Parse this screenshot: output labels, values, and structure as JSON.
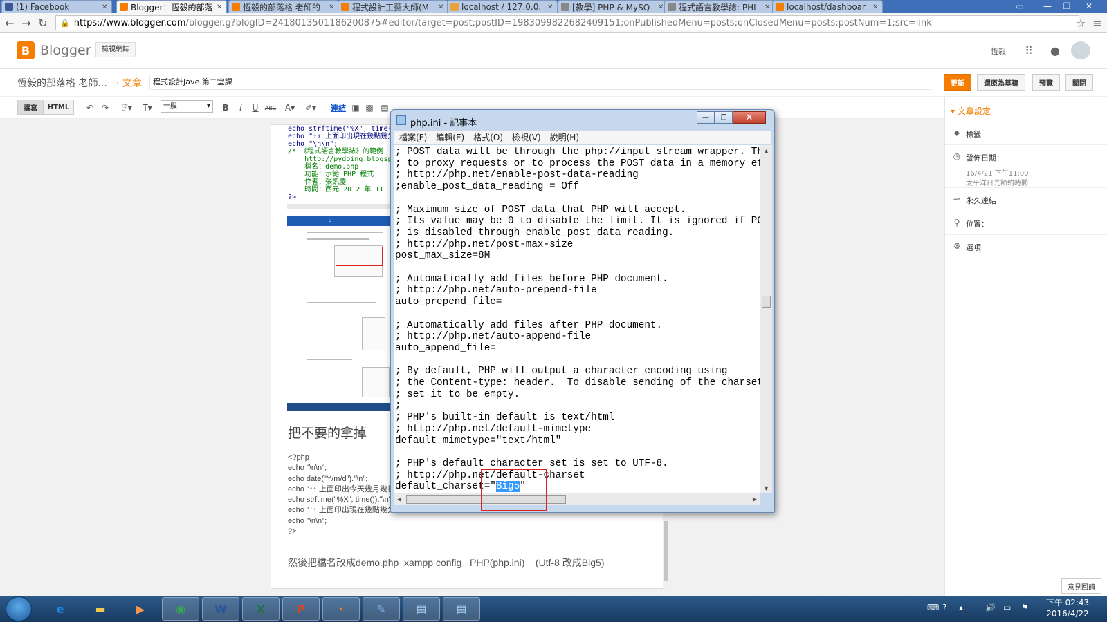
{
  "browser": {
    "tabs": [
      {
        "title": "(1) Facebook",
        "favicon": "facebook-icon",
        "color": "#3b5998"
      },
      {
        "title": "Blogger：恆毅的部落",
        "favicon": "blogger-icon",
        "color": "#f57d00"
      },
      {
        "title": "恆毅的部落格 老師的",
        "favicon": "blogger-icon",
        "color": "#f57d00"
      },
      {
        "title": "程式設計工藝大師(M",
        "favicon": "blogger-icon",
        "color": "#f57d00"
      },
      {
        "title": "localhost / 127.0.0.",
        "favicon": "phpmyadmin-icon",
        "color": "#e8a33d"
      },
      {
        "title": "[教學] PHP & MySQ",
        "favicon": "page-icon",
        "color": "#888888"
      },
      {
        "title": "程式語言教學誌: PHI",
        "favicon": "page-icon",
        "color": "#888888"
      },
      {
        "title": "localhost/dashboar",
        "favicon": "xampp-icon",
        "color": "#f57d00"
      }
    ],
    "url_host": "https://www.blogger.com",
    "url_rest": "/blogger.g?blogID=2418013501186200875#editor/target=post;postID=1983099822682409151;onPublishedMenu=posts;onClosedMenu=posts;postNum=1;src=link"
  },
  "blogger": {
    "logo_text": "Blogger",
    "view_blog": "檢視網誌",
    "user": "恆毅",
    "blog_title": "恆毅的部落格 老師...",
    "crumb": "· 文章",
    "post_title": "程式設計Jave 第二堂課",
    "buttons": {
      "update": "更新",
      "revert": "還原為草稿",
      "preview": "預覽",
      "close": "關閉"
    }
  },
  "toolbar": {
    "compose": "撰寫",
    "html": "HTML",
    "font_size": "一般",
    "link": "連結"
  },
  "editor": {
    "code_head": [
      "echo strftime(\"%X\", time()).\"\\n\";",
      "echo \"↑↑ 上面印出現在幾點幾分",
      "echo \"\\n\\n\";",
      "/* 《程式語言教學誌》的範例",
      "    http://pydoing.blogspo",
      "    檔名：demo.php",
      "    功能：示範 PHP 程式",
      "    作者：張凱慶",
      "    時間：西元 2012 年 11",
      "?>"
    ],
    "heading": "把不要的拿掉",
    "code_lines": [
      "<?php",
      "echo \"\\n\\n\";",
      "echo date(\"Y/m/d\").\"\\n\";",
      "echo \"↑↑ 上面印出今天幾月幾日",
      "echo strftime(\"%X\", time()).\"\\n\"",
      "echo \"↑↑ 上面印出現在幾點幾分",
      "echo \"\\n\\n\";",
      "?>"
    ],
    "bottom_line": "然後把檔名改成demo.php  xampp config   PHP(php.ini)    (Utf-8 改成Big5)"
  },
  "sidebar": {
    "title": "▾ 文章設定",
    "labels": "標籤",
    "publish_date": "發佈日期：",
    "publish_value": "16/4/21 下午11:00",
    "timezone": "太平洋日光節約時間",
    "permalink": "永久連結",
    "location": "位置：",
    "options": "選項"
  },
  "notepad": {
    "title": "php.ini - 記事本",
    "menu": [
      "檔案(F)",
      "編輯(E)",
      "格式(O)",
      "檢視(V)",
      "說明(H)"
    ],
    "lines": [
      "; POST data will be through the php://input stream wrapper. Th",
      "; to proxy requests or to process the POST data in a memory ef",
      "; http://php.net/enable-post-data-reading",
      ";enable_post_data_reading = Off",
      "",
      "; Maximum size of POST data that PHP will accept.",
      "; Its value may be 0 to disable the limit. It is ignored if PO",
      "; is disabled through enable_post_data_reading.",
      "; http://php.net/post-max-size",
      "post_max_size=8M",
      "",
      "; Automatically add files before PHP document.",
      "; http://php.net/auto-prepend-file",
      "auto_prepend_file=",
      "",
      "; Automatically add files after PHP document.",
      "; http://php.net/auto-append-file",
      "auto_append_file=",
      "",
      "; By default, PHP will output a character encoding using",
      "; the Content-type: header.  To disable sending of the charset",
      "; set it to be empty.",
      ";",
      "; PHP's built-in default is text/html",
      "; http://php.net/default-mimetype",
      "default_mimetype=\"text/html\"",
      "",
      "; PHP's default character set is set to UTF-8.",
      "; http://php.net/default-charset"
    ],
    "last_prefix": "default_charset=\"",
    "selected_value": "Big5",
    "last_suffix": "\""
  },
  "feedback": "意見回饋",
  "taskbar": {
    "apps": [
      {
        "name": "ie-icon",
        "glyph": "e",
        "color": "#1e88e5"
      },
      {
        "name": "explorer-icon",
        "glyph": "▬",
        "color": "#f2c94c"
      },
      {
        "name": "media-player-icon",
        "glyph": "▶",
        "color": "#f2994a"
      },
      {
        "name": "chrome-icon",
        "glyph": "◉",
        "color": "#34a853"
      },
      {
        "name": "word-icon",
        "glyph": "W",
        "color": "#2b579a"
      },
      {
        "name": "excel-icon",
        "glyph": "X",
        "color": "#217346"
      },
      {
        "name": "powerpoint-icon",
        "glyph": "P",
        "color": "#d24726"
      },
      {
        "name": "xampp-icon",
        "glyph": "ꞏ",
        "color": "#fb7a24"
      },
      {
        "name": "paint-icon",
        "glyph": "✎",
        "color": "#7fb2e5"
      },
      {
        "name": "notepad-icon",
        "glyph": "▤",
        "color": "#9fc7e8"
      },
      {
        "name": "notepad-active-icon",
        "glyph": "▤",
        "color": "#9fc7e8"
      }
    ],
    "clock_time": "下午 02:43",
    "clock_date": "2016/4/22"
  }
}
